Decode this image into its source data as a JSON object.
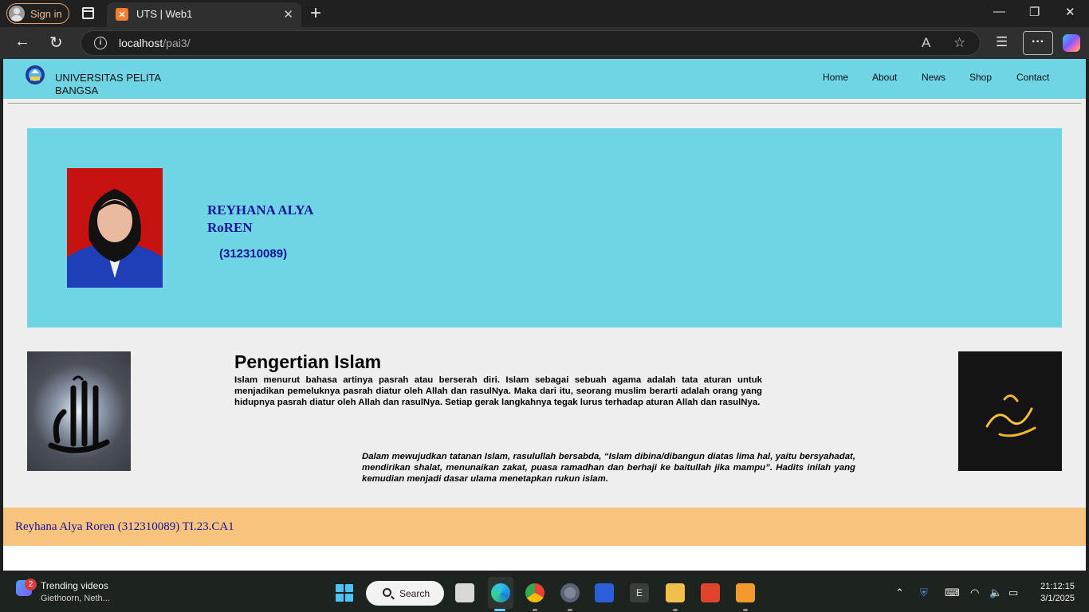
{
  "browser": {
    "sign_in_label": "Sign in",
    "tab_title": "UTS | Web1",
    "url_host": "localhost",
    "url_path": "/pai3/"
  },
  "site": {
    "brand": "UNIVERSITAS PELITA BANGSA",
    "nav": [
      "Home",
      "About",
      "News",
      "Shop",
      "Contact"
    ]
  },
  "profile": {
    "name": "REYHANA ALYA RoREN",
    "nim": "(312310089)"
  },
  "article": {
    "title": "Pengertian Islam",
    "body": "Islam menurut bahasa artinya pasrah atau berserah diri. Islam sebagai sebuah agama adalah tata aturan untuk menjadikan pemeluknya pasrah diatur oleh Allah dan rasulNya. Maka dari itu, seorang muslim berarti adalah orang yang hidupnya pasrah diatur oleh Allah dan rasulNya. Setiap gerak langkahnya tegak lurus terhadap aturan Allah dan rasulNya.",
    "hadith": "Dalam mewujudkan tatanan Islam, rasulullah bersabda, “Islam dibina/dibangun diatas lima hal, yaitu bersyahadat, mendirikan shalat, menunaikan zakat, puasa ramadhan dan berhaji ke baitullah jika mampu”. Hadits inilah yang kemudian menjadi dasar ulama menetapkan rukun islam."
  },
  "footer": {
    "text": "Reyhana Alya Roren (312310089) TI.23.CA1"
  },
  "taskbar": {
    "widget_badge": "2",
    "widget_title": "Trending videos",
    "widget_subtitle": "Giethoorn, Neth...",
    "search_label": "Search",
    "time": "21:12:15",
    "date": "3/1/2025"
  },
  "colors": {
    "header_bg": "#6fd4e3",
    "footer_bg": "#f8c37c",
    "name_color": "#14149a"
  }
}
